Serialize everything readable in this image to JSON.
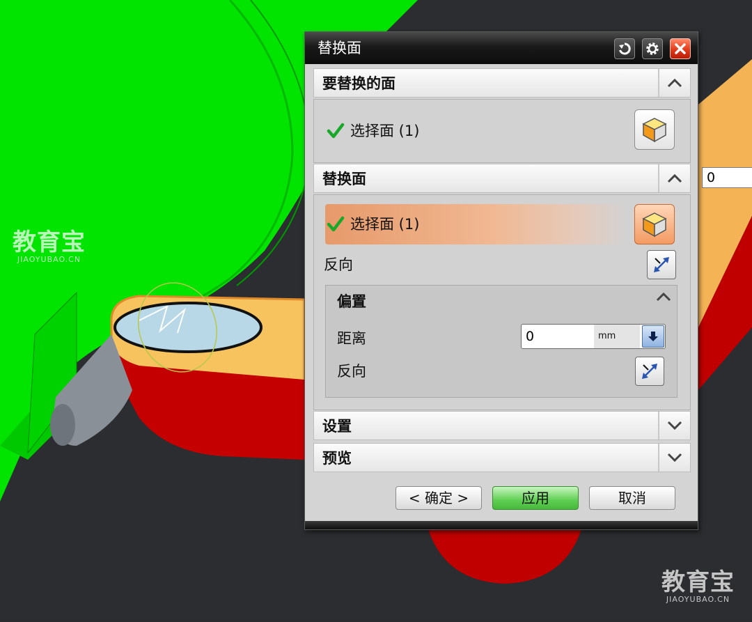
{
  "dialog": {
    "title": "替换面",
    "sections": {
      "faces_to_replace": {
        "title": "要替换的面",
        "select_label": "选择面 (1)"
      },
      "replacement_face": {
        "title": "替换面",
        "select_label": "选择面 (1)",
        "reverse_label": "反向"
      },
      "offset": {
        "title": "偏置",
        "distance_label": "距离",
        "distance_value": "0",
        "distance_unit": "mm",
        "reverse_label": "反向"
      },
      "settings": {
        "title": "设置"
      },
      "preview": {
        "title": "预览"
      }
    },
    "footer": {
      "ok_label": "< 确定 >",
      "apply_label": "应用",
      "cancel_label": "取消"
    }
  },
  "viewport": {
    "side_input_value": "0",
    "watermark_left": {
      "main": "教育宝",
      "sub": "JIAOYUBAO.CN"
    },
    "watermark_right": {
      "main": "教育宝",
      "sub": "JIAOYUBAO.CN"
    }
  },
  "colors": {
    "part_green": "#00e600",
    "part_orange": "#f7c35f",
    "part_red": "#c40000",
    "highlight_orange": "#f0a574",
    "apply_green": "#5fcf52"
  }
}
